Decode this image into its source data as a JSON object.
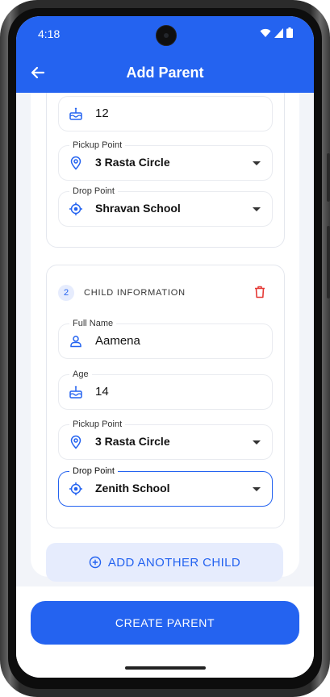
{
  "status": {
    "time": "4:18"
  },
  "appbar": {
    "title": "Add Parent"
  },
  "child1": {
    "age_value": "12",
    "pickup": {
      "label": "Pickup Point",
      "value": "3 Rasta Circle"
    },
    "drop": {
      "label": "Drop Point",
      "value": "Shravan School"
    }
  },
  "child2": {
    "number": "2",
    "section_title": "CHILD INFORMATION",
    "full_name": {
      "label": "Full Name",
      "value": "Aamena"
    },
    "age": {
      "label": "Age",
      "value": "14"
    },
    "pickup": {
      "label": "Pickup Point",
      "value": "3 Rasta Circle"
    },
    "drop": {
      "label": "Drop Point",
      "value": "Zenith School"
    }
  },
  "actions": {
    "add_child": "ADD ANOTHER CHILD",
    "create": "CREATE PARENT"
  },
  "colors": {
    "primary": "#2463f0",
    "danger": "#e53935",
    "light_blue": "#e6ecfd"
  }
}
